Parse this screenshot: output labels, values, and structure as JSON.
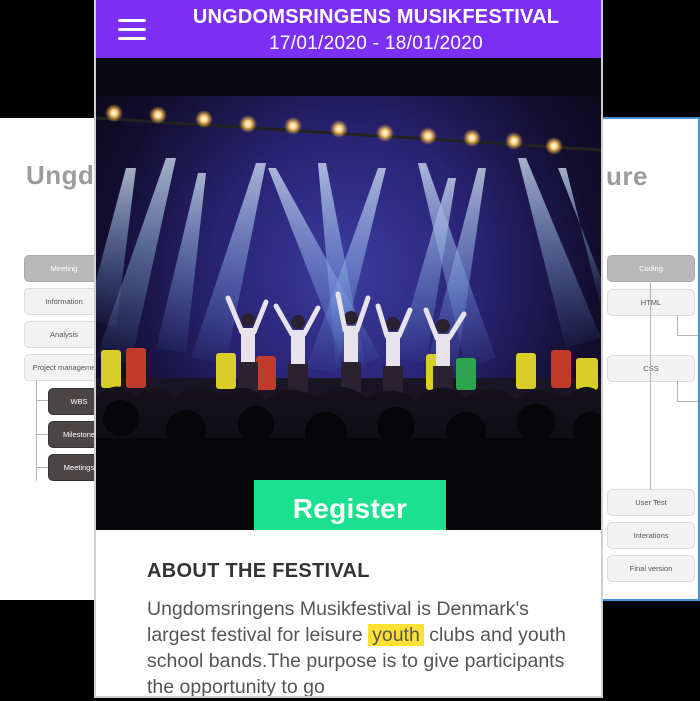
{
  "left_slide": {
    "title": "Ungd",
    "nodes": [
      "Meeting",
      "Information",
      "Analysis",
      "Project manageme"
    ],
    "sub_nodes": [
      "WBS",
      "Milestone",
      "Meetings"
    ]
  },
  "right_slide": {
    "title": "ure",
    "nodes": [
      "Coding",
      "HTML",
      "CSS",
      "User Test",
      "Interations",
      "Final version"
    ]
  },
  "header": {
    "title": "UNGDOMSRINGENS MUSIKFESTIVAL",
    "dates": "17/01/2020 - 18/01/2020"
  },
  "hero": {
    "register_label": "Register"
  },
  "about": {
    "heading": "ABOUT THE FESTIVAL",
    "text_before": "Ungdomsringens Musikfestival is Denmark's largest festival for leisure ",
    "highlight": "youth",
    "text_after": " clubs and youth school bands.The purpose is to give participants the opportunity to go"
  },
  "colors": {
    "header_bg": "#7b2ff7",
    "register_bg": "#1be08e",
    "highlight": "#ffe033"
  },
  "icons": [
    "hamburger-menu-icon"
  ]
}
